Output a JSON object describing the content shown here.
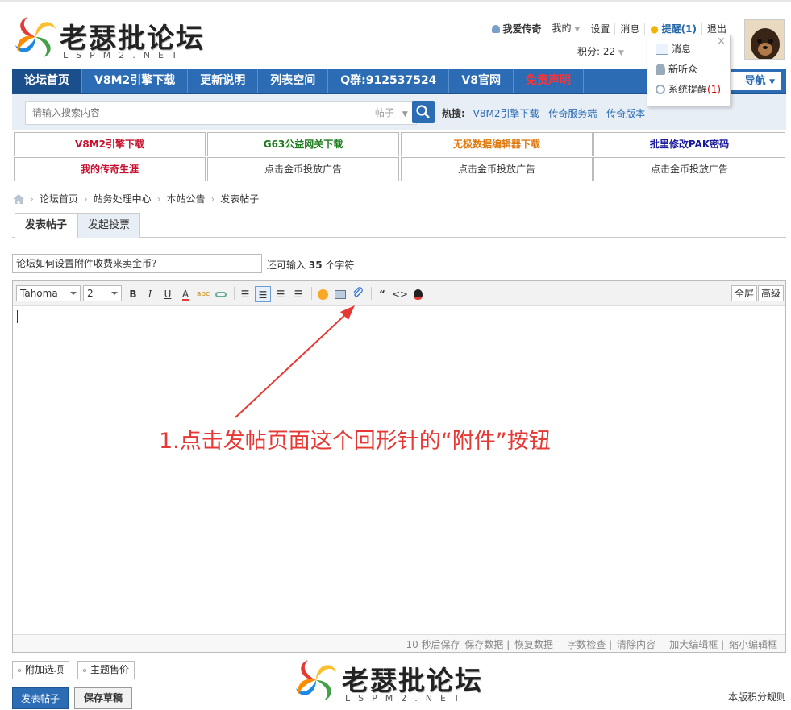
{
  "logo": {
    "text": "老瑟批论坛",
    "sub": "LSPM2.NET"
  },
  "userbar": {
    "username": "我爱传奇",
    "mine": "我的",
    "settings": "设置",
    "messages": "消息",
    "remind": "提醒(1)",
    "logout": "退出",
    "credits": "积分: 22"
  },
  "popup": {
    "items": [
      {
        "label": "消息"
      },
      {
        "label": "新听众"
      },
      {
        "label": "系统提醒",
        "count": "(1)"
      }
    ]
  },
  "nav": {
    "items": [
      "论坛首页",
      "V8M2引擎下载",
      "更新说明",
      "列表空间",
      "Q群:912537524",
      "V8官网",
      "免责声明"
    ],
    "guide": "导航"
  },
  "search": {
    "placeholder": "请输入搜索内容",
    "type": "帖子",
    "hot_label": "热搜:",
    "hot": [
      "V8M2引擎下载",
      "传奇服务端",
      "传奇版本"
    ]
  },
  "links": [
    {
      "label": "V8M2引擎下载",
      "color": "#c8102e"
    },
    {
      "label": "G63公益网关下载",
      "color": "#1b7a1b"
    },
    {
      "label": "无极数据编辑器下载",
      "color": "#e07a10"
    },
    {
      "label": "批里修改PAK密码",
      "color": "#1a1a9c"
    },
    {
      "label": "我的传奇生涯",
      "color": "#c8102e"
    },
    {
      "label": "点击金币投放广告",
      "color": "#333333"
    },
    {
      "label": "点击金币投放广告",
      "color": "#333333"
    },
    {
      "label": "点击金币投放广告",
      "color": "#333333"
    }
  ],
  "breadcrumb": [
    "论坛首页",
    "站务处理中心",
    "本站公告",
    "发表帖子"
  ],
  "tabs": [
    "发表帖子",
    "发起投票"
  ],
  "subject": {
    "value": "论坛如何设置附件收费来卖金币?",
    "hint_pre": "还可输入",
    "hint_num": "35",
    "hint_post": "个字符"
  },
  "editor": {
    "font": "Tahoma",
    "size": "2",
    "fullscreen": "全屏",
    "advanced": "高级",
    "annotation": "1.点击发帖页面这个回形针的“附件”按钮",
    "status": [
      "10 秒后保存",
      "保存数据",
      "恢复数据",
      "字数检查",
      "清除内容",
      "加大编辑框",
      "缩小编辑框"
    ]
  },
  "bottom": {
    "options": [
      "附加选项",
      "主题售价"
    ],
    "post": "发表帖子",
    "draft": "保存草稿",
    "rules": "本版积分规则"
  }
}
